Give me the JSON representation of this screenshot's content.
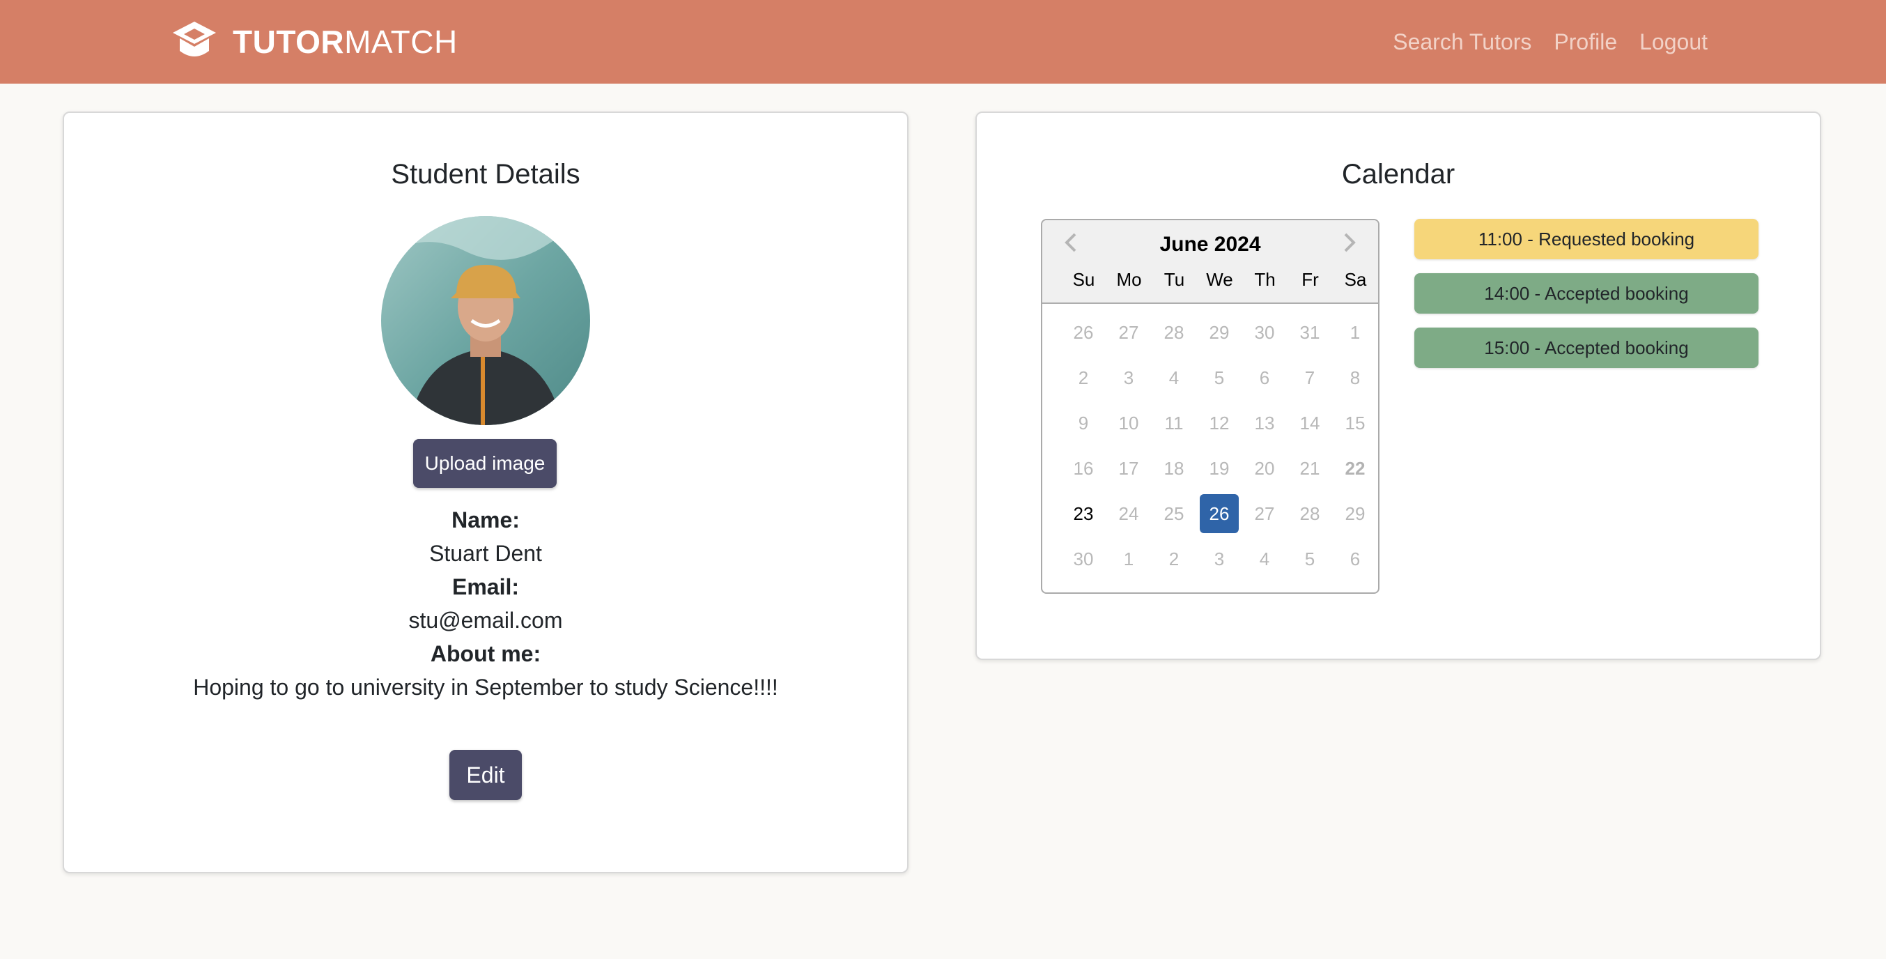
{
  "brand": {
    "bold": "TUTOR",
    "light": "MATCH",
    "icon": "graduation-cap-icon"
  },
  "nav": {
    "items": [
      "Search Tutors",
      "Profile",
      "Logout"
    ]
  },
  "student": {
    "title": "Student Details",
    "upload_label": "Upload image",
    "name_label": "Name:",
    "name": "Stuart Dent",
    "email_label": "Email:",
    "email": "stu@email.com",
    "about_label": "About me:",
    "about": "Hoping to go to university in September to study Science!!!!",
    "edit_label": "Edit"
  },
  "calendar": {
    "title": "Calendar",
    "month": "June 2024",
    "weekdays": [
      "Su",
      "Mo",
      "Tu",
      "We",
      "Th",
      "Fr",
      "Sa"
    ],
    "weeks": [
      [
        "26",
        "27",
        "28",
        "29",
        "30",
        "31",
        "1"
      ],
      [
        "2",
        "3",
        "4",
        "5",
        "6",
        "7",
        "8"
      ],
      [
        "9",
        "10",
        "11",
        "12",
        "13",
        "14",
        "15"
      ],
      [
        "16",
        "17",
        "18",
        "19",
        "20",
        "21",
        "22"
      ],
      [
        "23",
        "24",
        "25",
        "26",
        "27",
        "28",
        "29"
      ],
      [
        "30",
        "1",
        "2",
        "3",
        "4",
        "5",
        "6"
      ]
    ],
    "selected": "26",
    "today": "23",
    "bold_day": "22",
    "bookings": [
      {
        "label": "11:00 - Requested booking",
        "color": "#f6d67a"
      },
      {
        "label": "14:00 - Accepted booking",
        "color": "#7eab86"
      },
      {
        "label": "15:00 - Accepted booking",
        "color": "#7eab86"
      }
    ]
  },
  "colors": {
    "navbar": "#d57f66",
    "button": "#4b4b68",
    "selected_day": "#2f64a8"
  }
}
